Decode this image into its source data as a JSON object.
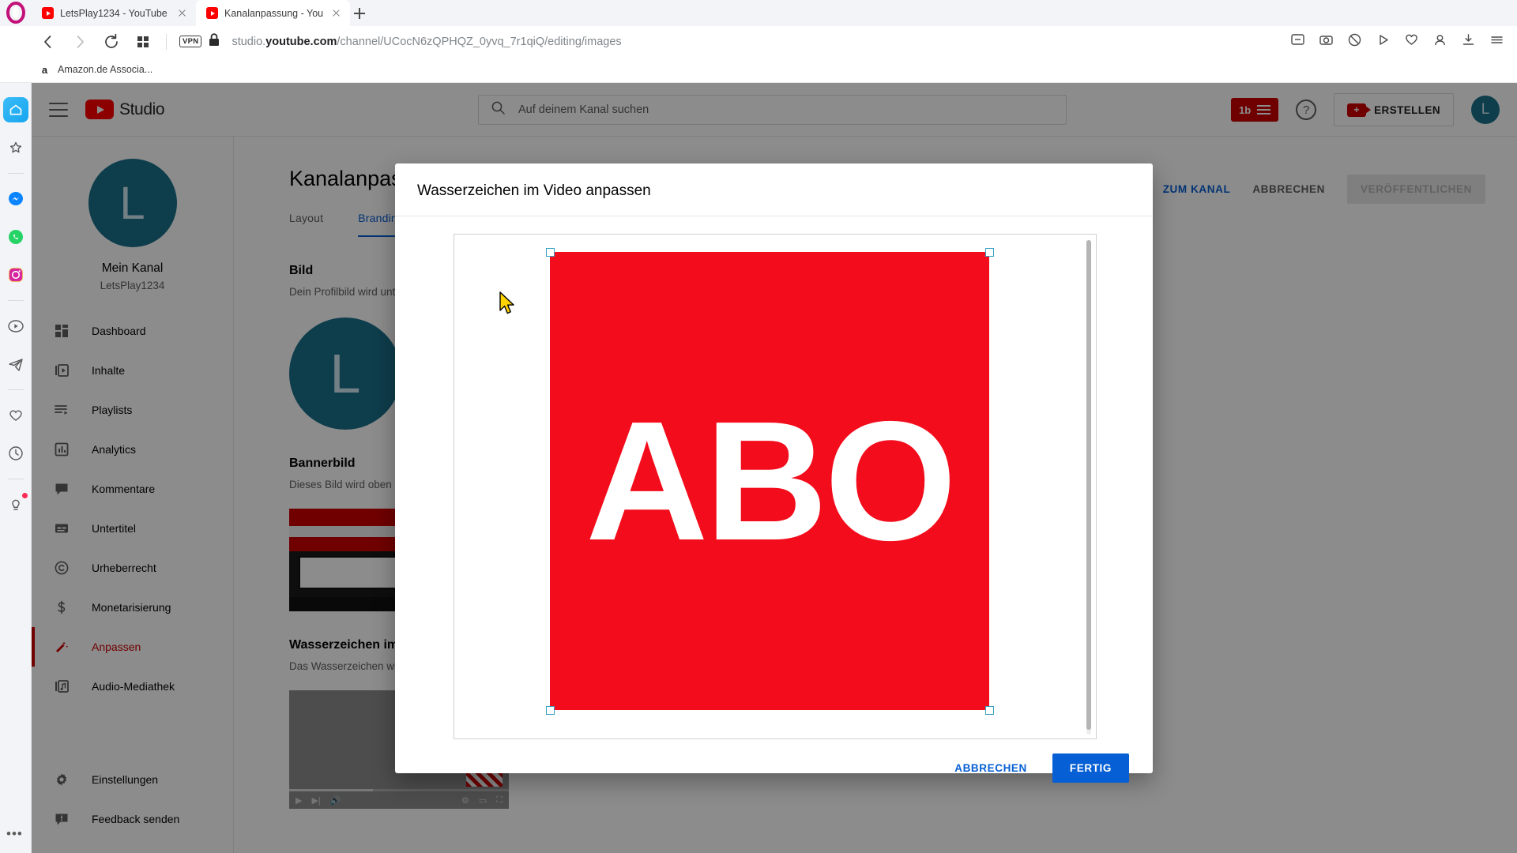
{
  "browser": {
    "tabs": [
      {
        "title": "LetsPlay1234 - YouTube",
        "active": false,
        "favicon": "youtube-icon"
      },
      {
        "title": "Kanalanpassung - YouTube",
        "active": true,
        "favicon": "youtube-icon"
      }
    ],
    "newtab_label": "+",
    "vpn_label": "VPN",
    "url": {
      "prefix": "studio.",
      "host": "youtube.com",
      "path": "/channel/UCocN6zQPHQZ_0yvq_7r1qiQ/editing/images"
    },
    "bookmarks": [
      {
        "label": "Amazon.de Associa...",
        "icon": "amazon-icon"
      }
    ],
    "rail_icons": [
      "home-icon",
      "star-icon",
      "messenger-icon",
      "whatsapp-icon",
      "instagram-icon",
      "player-icon",
      "telegram-icon",
      "heart-icon",
      "history-icon",
      "tips-icon"
    ]
  },
  "studio": {
    "logo_text": "Studio",
    "search": {
      "placeholder": "Auf deinem Kanal suchen",
      "value": ""
    },
    "header": {
      "subscribers_chip": "1b",
      "create_label": "ERSTELLEN",
      "avatar_letter": "L"
    },
    "channel": {
      "avatar_letter": "L",
      "name": "Mein Kanal",
      "handle": "LetsPlay1234"
    },
    "nav": [
      {
        "label": "Dashboard",
        "icon": "dashboard-icon",
        "active": false
      },
      {
        "label": "Inhalte",
        "icon": "content-icon",
        "active": false
      },
      {
        "label": "Playlists",
        "icon": "playlist-icon",
        "active": false
      },
      {
        "label": "Analytics",
        "icon": "analytics-icon",
        "active": false
      },
      {
        "label": "Kommentare",
        "icon": "comments-icon",
        "active": false
      },
      {
        "label": "Untertitel",
        "icon": "subtitles-icon",
        "active": false
      },
      {
        "label": "Urheberrecht",
        "icon": "copyright-icon",
        "active": false
      },
      {
        "label": "Monetarisierung",
        "icon": "dollar-icon",
        "active": false
      },
      {
        "label": "Anpassen",
        "icon": "magicwand-icon",
        "active": true
      },
      {
        "label": "Audio-Mediathek",
        "icon": "music-icon",
        "active": false
      }
    ],
    "nav_bottom": [
      {
        "label": "Einstellungen",
        "icon": "gear-icon"
      },
      {
        "label": "Feedback senden",
        "icon": "feedback-icon"
      }
    ],
    "page": {
      "title": "Kanalanpassung",
      "actions": {
        "view_channel": "ZUM KANAL",
        "cancel": "ABBRECHEN",
        "publish": "VERÖFFENTLICHEN"
      },
      "tabs": [
        {
          "label": "Layout",
          "active": false
        },
        {
          "label": "Branding",
          "active": true
        }
      ],
      "sections": [
        {
          "heading": "Bild",
          "description": "Dein Profilbild wird unter anderen"
        },
        {
          "heading": "Bannerbild",
          "description": "Dieses Bild wird oben auf deine"
        },
        {
          "heading": "Wasserzeichen im Video",
          "description": "Das Wasserzeichen wird in der"
        }
      ]
    }
  },
  "modal": {
    "title": "Wasserzeichen im Video anpassen",
    "image_text": "ABO",
    "image_color": "#f30c1b",
    "buttons": {
      "cancel": "ABBRECHEN",
      "done": "FERTIG"
    },
    "handles": 4
  },
  "colors": {
    "youtube_red": "#ff0000",
    "studio_accent": "#065fd4",
    "active_nav": "#cc0000",
    "avatar_bg": "#1a6f8b"
  }
}
